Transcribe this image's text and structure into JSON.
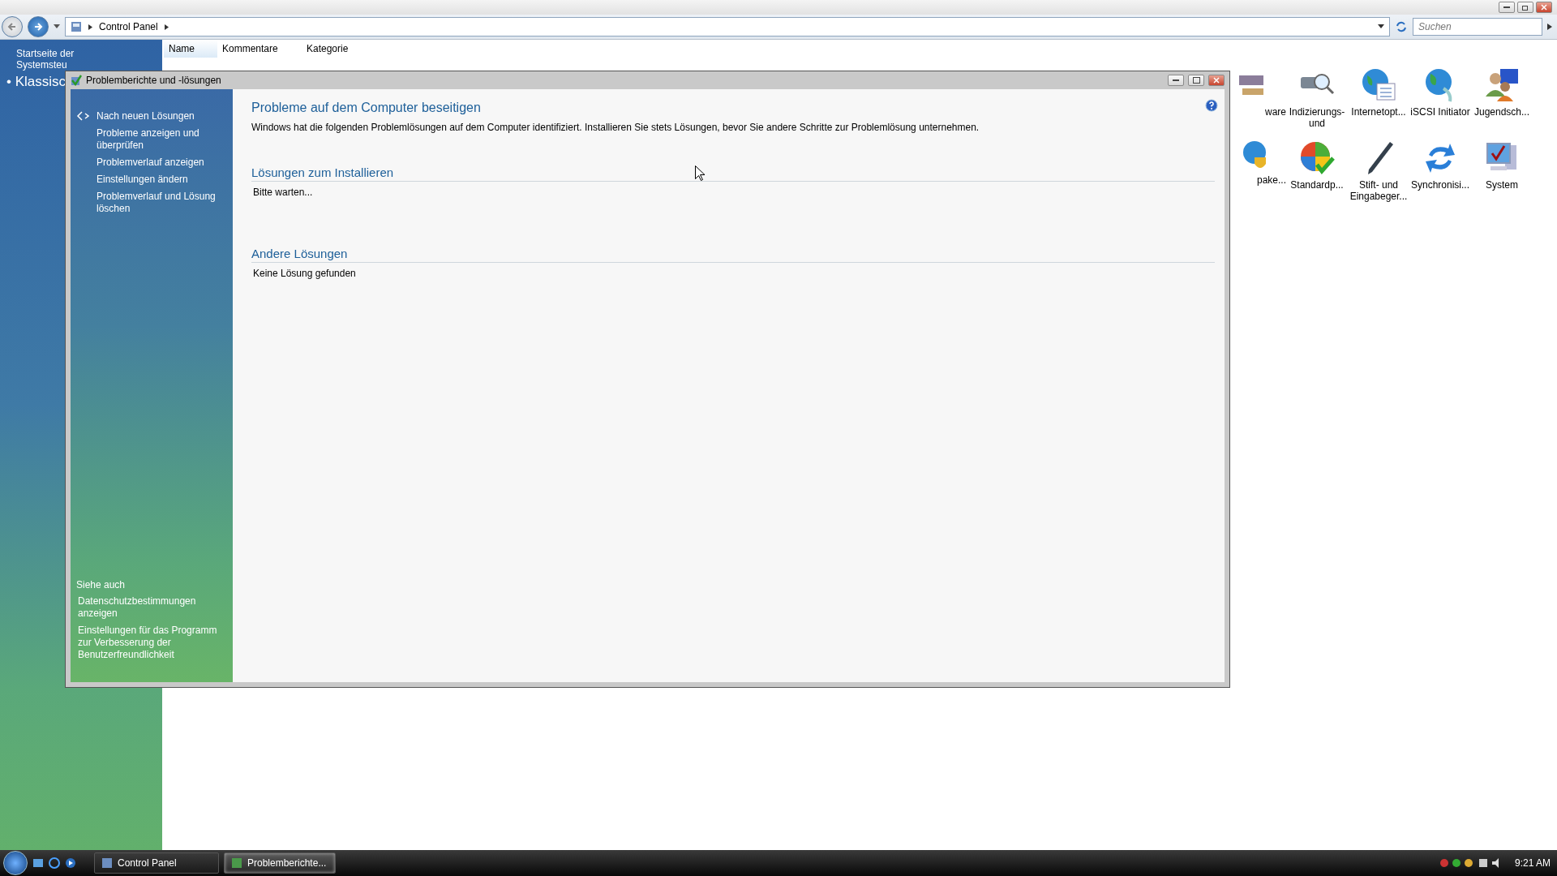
{
  "explorer": {
    "address": [
      "Control Panel"
    ],
    "search": {
      "placeholder": "Suchen"
    },
    "nav": [
      {
        "label": "Startseite der Systemsteu",
        "kind": "link"
      },
      {
        "label": "• Klassisc",
        "kind": "bullet"
      }
    ],
    "columns": [
      {
        "label": "Name",
        "selected": true
      },
      {
        "label": "Kommentare",
        "selected": false
      },
      {
        "label": "Kategorie",
        "selected": false
      }
    ],
    "items": [
      {
        "label": "ware",
        "kind": "hardware"
      },
      {
        "label": "Indizierungs- und",
        "kind": "index"
      },
      {
        "label": "Internetopt...",
        "kind": "globe-list"
      },
      {
        "label": "iSCSI Initiator",
        "kind": "globe-plug"
      },
      {
        "label": "Jugendsch...",
        "kind": "people"
      },
      {
        "label": "pake...",
        "kind": "globe-shield"
      },
      {
        "label": "Standardp...",
        "kind": "default"
      },
      {
        "label": "Stift- und Eingabeger...",
        "kind": "pen"
      },
      {
        "label": "Synchronisi...",
        "kind": "sync"
      },
      {
        "label": "System",
        "kind": "system"
      }
    ]
  },
  "dialog": {
    "title": "Problemberichte und -lösungen",
    "tasks": [
      {
        "label": "Nach neuen Lösungen",
        "kind": "action"
      },
      {
        "label": "Probleme anzeigen und überprüfen",
        "kind": "link"
      },
      {
        "label": "Problemverlauf anzeigen",
        "kind": "link"
      },
      {
        "label": "Einstellungen ändern",
        "kind": "link"
      },
      {
        "label": "Problemverlauf und Lösung löschen",
        "kind": "link"
      }
    ],
    "see_also": {
      "title": "Siehe auch",
      "links": [
        "Datenschutzbestimmungen anzeigen",
        "Einstellungen für das Programm zur Verbesserung der Benutzerfreundlichkeit"
      ]
    },
    "heading": "Probleme auf dem Computer beseitigen",
    "intro": "Windows hat die folgenden Problemlösungen auf dem Computer identifiziert. Installieren Sie stets Lösungen, bevor Sie andere Schritte zur Problemlösung unternehmen.",
    "sections": [
      {
        "title": "Lösungen zum Installieren",
        "text": "Bitte warten..."
      },
      {
        "title": "Andere Lösungen",
        "text": "Keine Lösung gefunden"
      }
    ]
  },
  "taskbar": {
    "tasks": [
      {
        "label": "Control Panel",
        "selected": false
      },
      {
        "label": "Problemberichte...",
        "selected": true
      }
    ],
    "time": "9:21 AM"
  }
}
